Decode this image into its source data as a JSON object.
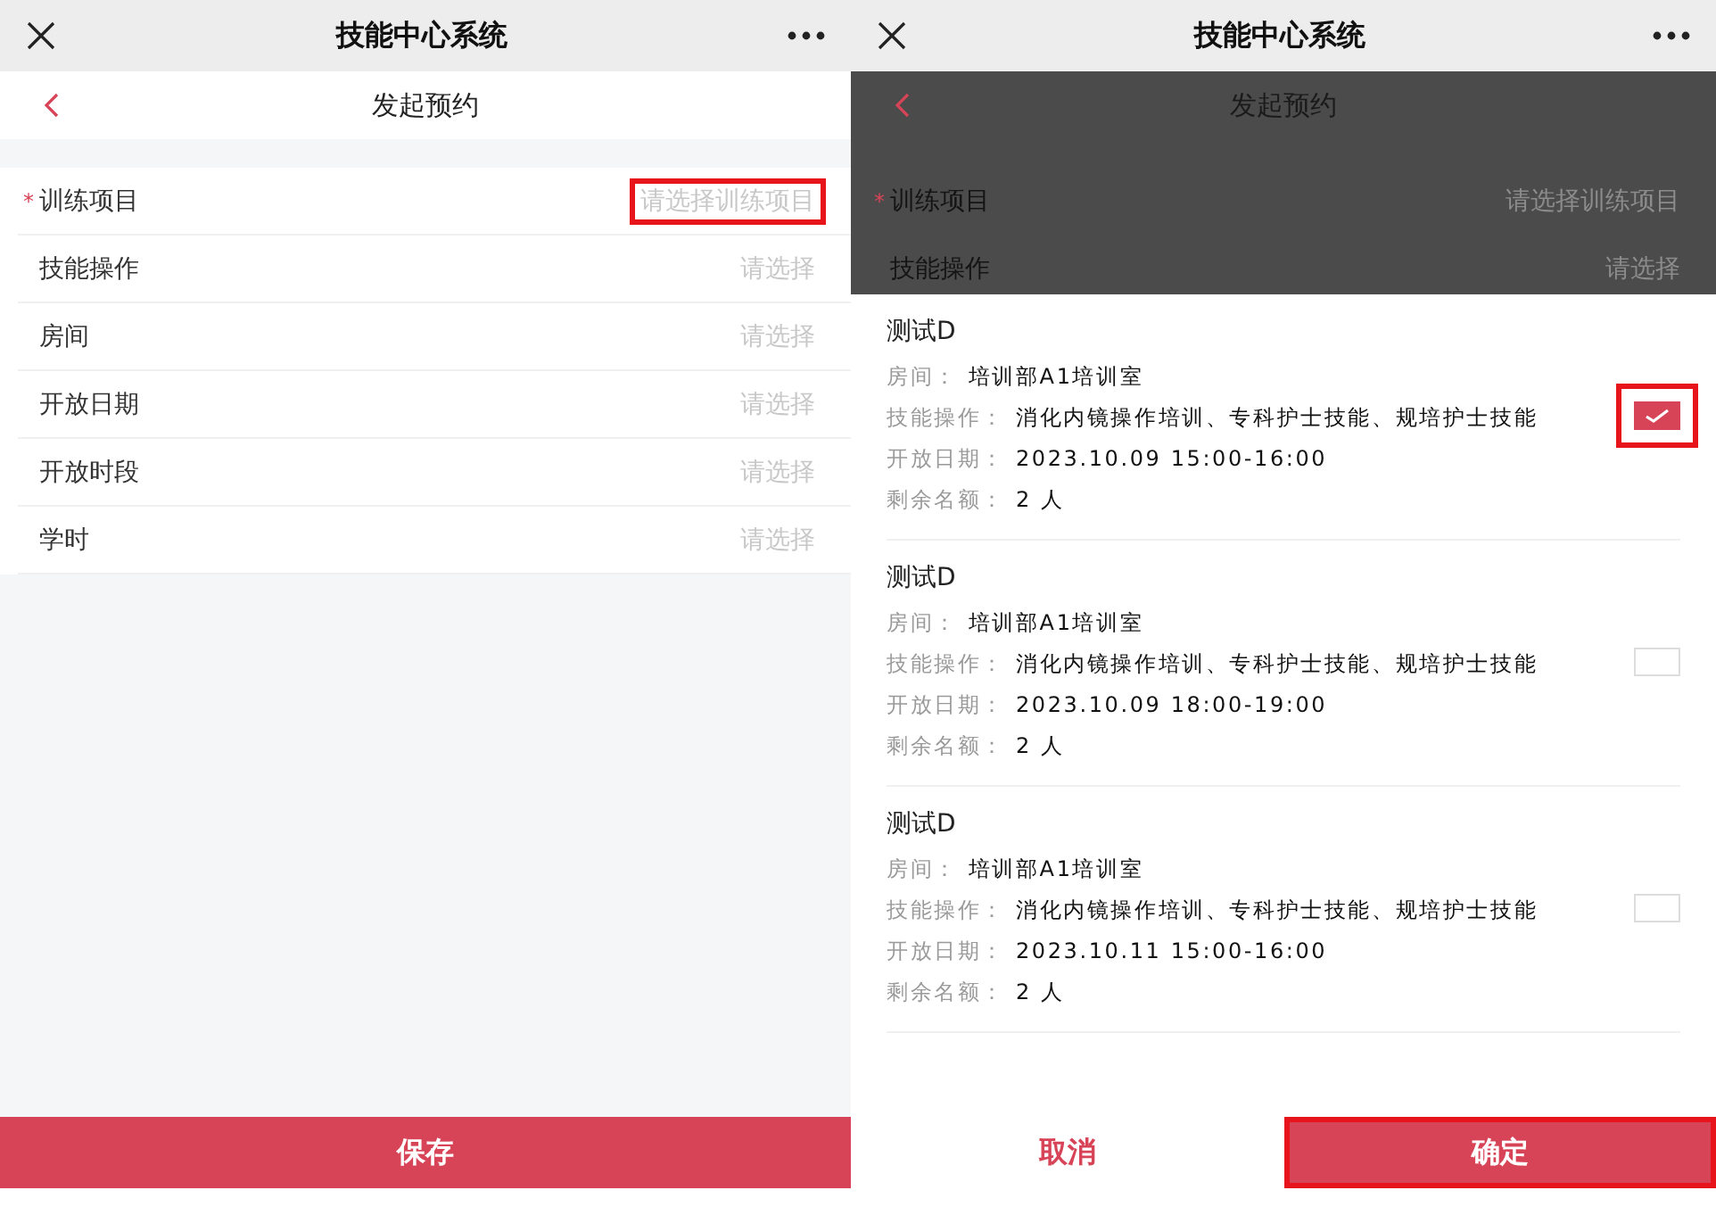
{
  "left_screen": {
    "app_bar": {
      "title": "技能中心系统"
    },
    "page": {
      "title": "发起预约"
    },
    "fields": [
      {
        "required_mark": "*",
        "label": "训练项目",
        "placeholder": "请选择训练项目",
        "highlighted": true
      },
      {
        "label": "技能操作",
        "placeholder": "请选择",
        "highlighted": false
      },
      {
        "label": "房间",
        "placeholder": "请选择",
        "highlighted": false
      },
      {
        "label": "开放日期",
        "placeholder": "请选择",
        "highlighted": false
      },
      {
        "label": "开放时段",
        "placeholder": "请选择",
        "highlighted": false
      },
      {
        "label": "学时",
        "placeholder": "请选择",
        "highlighted": false
      }
    ],
    "save_button": {
      "label": "保存"
    }
  },
  "right_screen": {
    "app_bar": {
      "title": "技能中心系统"
    },
    "page": {
      "title": "发起预约"
    },
    "fields": [
      {
        "required_mark": "*",
        "label": "训练项目",
        "placeholder": "请选择训练项目",
        "highlighted": false
      },
      {
        "label": "技能操作",
        "placeholder": "请选择",
        "highlighted": false
      }
    ],
    "options": [
      {
        "title": "测试D",
        "room_label": "房间：",
        "room": "培训部A1培训室",
        "skills_label": "技能操作：",
        "skills": "消化内镜操作培训、专科护士技能、规培护士技能",
        "date_label": "开放日期：",
        "date": "2023.10.09 15:00-16:00",
        "quota_label": "剩余名额：",
        "quota": "2 人",
        "selected": true,
        "highlighted": true
      },
      {
        "title": "测试D",
        "room_label": "房间：",
        "room": "培训部A1培训室",
        "skills_label": "技能操作：",
        "skills": "消化内镜操作培训、专科护士技能、规培护士技能",
        "date_label": "开放日期：",
        "date": "2023.10.09 18:00-19:00",
        "quota_label": "剩余名额：",
        "quota": "2 人",
        "selected": false,
        "highlighted": false
      },
      {
        "title": "测试D",
        "room_label": "房间：",
        "room": "培训部A1培训室",
        "skills_label": "技能操作：",
        "skills": "消化内镜操作培训、专科护士技能、规培护士技能",
        "date_label": "开放日期：",
        "date": "2023.10.11 15:00-16:00",
        "quota_label": "剩余名额：",
        "quota": "2 人",
        "selected": false,
        "highlighted": false
      }
    ],
    "cancel_button": {
      "label": "取消"
    },
    "confirm_button": {
      "label": "确定",
      "highlighted": true
    }
  }
}
